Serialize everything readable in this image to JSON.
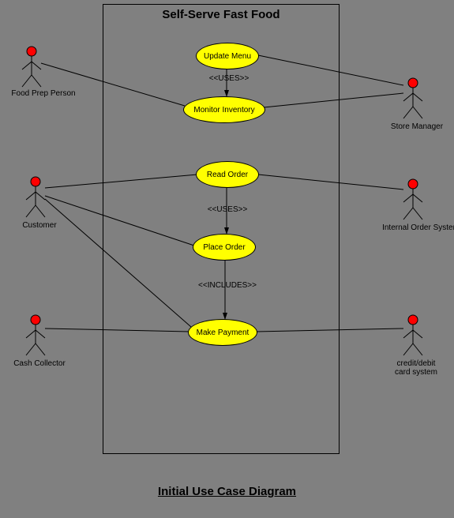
{
  "title": "Self-Serve Fast Food",
  "caption": "Initial Use Case Diagram",
  "actors": {
    "food_prep_person": "Food Prep Person",
    "customer": "Customer",
    "cash_collector": "Cash Collector",
    "store_manager": "Store Manager",
    "internal_order_system": "Internal Order System",
    "credit_debit_card_system": "credit/debit\ncard system"
  },
  "usecases": {
    "update_menu": "Update Menu",
    "monitor_inventory": "Monitor Inventory",
    "read_order": "Read Order",
    "place_order": "Place Order",
    "make_payment": "Make Payment"
  },
  "relations": {
    "uses1": "<<USES>>",
    "uses2": "<<USES>>",
    "includes": "<<INCLUDES>>"
  }
}
